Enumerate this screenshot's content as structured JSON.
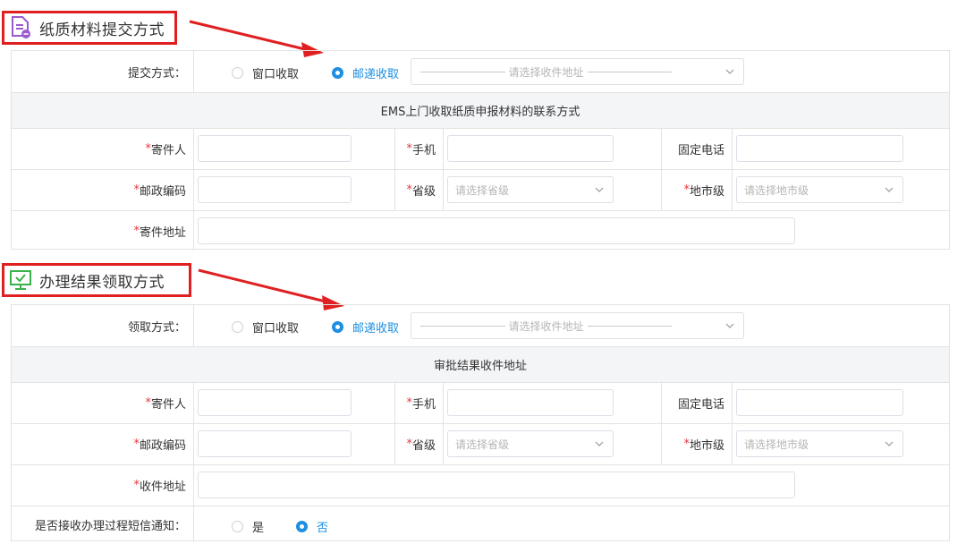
{
  "section1": {
    "title": "纸质材料提交方式",
    "method_label": "提交方式：",
    "option_window": "窗口收取",
    "option_post": "邮递收取",
    "address_select_placeholder": "请选择收件地址",
    "banner": "EMS上门收取纸质申报材料的联系方式",
    "sender_label": "寄件人",
    "phone_label": "手机",
    "landline_label": "固定电话",
    "postcode_label": "邮政编码",
    "province_label": "省级",
    "province_placeholder": "请选择省级",
    "city_label": "地市级",
    "city_placeholder": "请选择地市级",
    "address_label": "寄件地址"
  },
  "section2": {
    "title": "办理结果领取方式",
    "method_label": "领取方式：",
    "option_window": "窗口收取",
    "option_post": "邮递收取",
    "address_select_placeholder": "请选择收件地址",
    "banner": "审批结果收件地址",
    "sender_label": "寄件人",
    "phone_label": "手机",
    "landline_label": "固定电话",
    "postcode_label": "邮政编码",
    "province_label": "省级",
    "province_placeholder": "请选择省级",
    "city_label": "地市级",
    "city_placeholder": "请选择地市级",
    "address_label": "收件地址",
    "sms_label": "是否接收办理过程短信通知：",
    "sms_yes": "是",
    "sms_no": "否"
  },
  "required_mark": "*",
  "colors": {
    "highlight_border": "#e02020",
    "accent": "#1e8fe1",
    "required": "#e5353c"
  }
}
